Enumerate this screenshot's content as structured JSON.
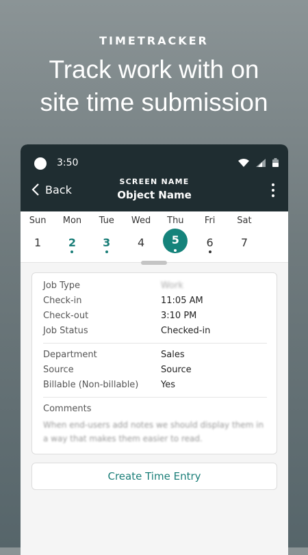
{
  "promo": {
    "eyebrow": "TIMETRACKER",
    "headline_line1": "Track work with on",
    "headline_line2": "site time submission"
  },
  "status_bar": {
    "time": "3:50",
    "icons": [
      "circle-indicator-icon",
      "wifi-icon",
      "signal-icon",
      "battery-icon"
    ]
  },
  "app_bar": {
    "back_label": "Back",
    "screen_name": "SCREEN NAME",
    "object_name": "Object Name",
    "menu_icon": "more-vertical-icon"
  },
  "week": {
    "days": [
      {
        "name": "Sun",
        "num": "1",
        "state": "normal",
        "dot": "none"
      },
      {
        "name": "Mon",
        "num": "2",
        "state": "teal",
        "dot": "teal"
      },
      {
        "name": "Tue",
        "num": "3",
        "state": "teal",
        "dot": "teal"
      },
      {
        "name": "Wed",
        "num": "4",
        "state": "normal",
        "dot": "none"
      },
      {
        "name": "Thu",
        "num": "5",
        "state": "selected",
        "dot": "white"
      },
      {
        "name": "Fri",
        "num": "6",
        "state": "normal",
        "dot": "dark"
      },
      {
        "name": "Sat",
        "num": "7",
        "state": "normal",
        "dot": "none"
      }
    ]
  },
  "details": {
    "section1": [
      {
        "label": "Job Type",
        "value": "Work"
      },
      {
        "label": "Check-in",
        "value": "11:05 AM"
      },
      {
        "label": "Check-out",
        "value": "3:10 PM"
      },
      {
        "label": "Job Status",
        "value": "Checked-in"
      }
    ],
    "section2": [
      {
        "label": "Department",
        "value": "Sales"
      },
      {
        "label": "Source",
        "value": "Source"
      },
      {
        "label": "Billable (Non-billable)",
        "value": "Yes"
      }
    ],
    "comments_label": "Comments",
    "comments_text": "When end-users add notes we should display them in a way that makes them easier to read."
  },
  "actions": {
    "create_label": "Create Time Entry"
  },
  "colors": {
    "accent": "#15837b",
    "appbar": "#1f2d31"
  }
}
